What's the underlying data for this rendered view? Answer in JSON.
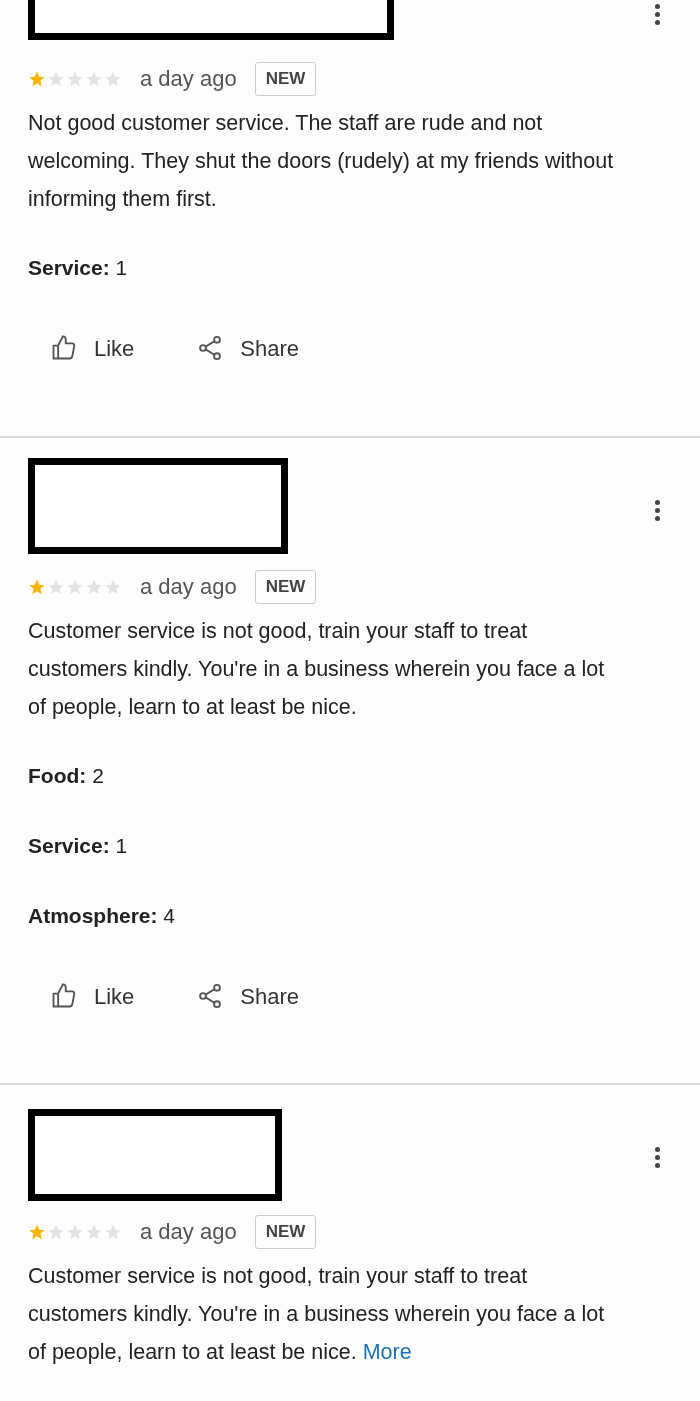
{
  "reviews": [
    {
      "stars": 1,
      "time": "a day ago",
      "badge": "NEW",
      "text": "Not good customer service. The staff are rude and not welcoming. They shut the doors (rudely) at my friends without informing them first.",
      "ratings": [
        "**Service:** 1"
      ],
      "actions": [
        "Like",
        "Share"
      ]
    },
    {
      "stars": 1,
      "time": "a day ago",
      "badge": "NEW",
      "text": "Customer service is not good, train your staff to treat customers kindly. You're in a business wherein you face a lot of people, learn to at least be nice.",
      "ratings": [
        "**Food:** 2",
        "**Service:** 1",
        "**Atmosphere:** 4"
      ],
      "actions": [
        "Like",
        "Share"
      ]
    },
    {
      "stars": 1,
      "time": "a day ago",
      "badge": "NEW",
      "text": "Customer service is not good, train your staff to treat customers kindly. You're in a business wherein you face a lot of people, learn to at least be nice.",
      "more": "More"
    }
  ]
}
